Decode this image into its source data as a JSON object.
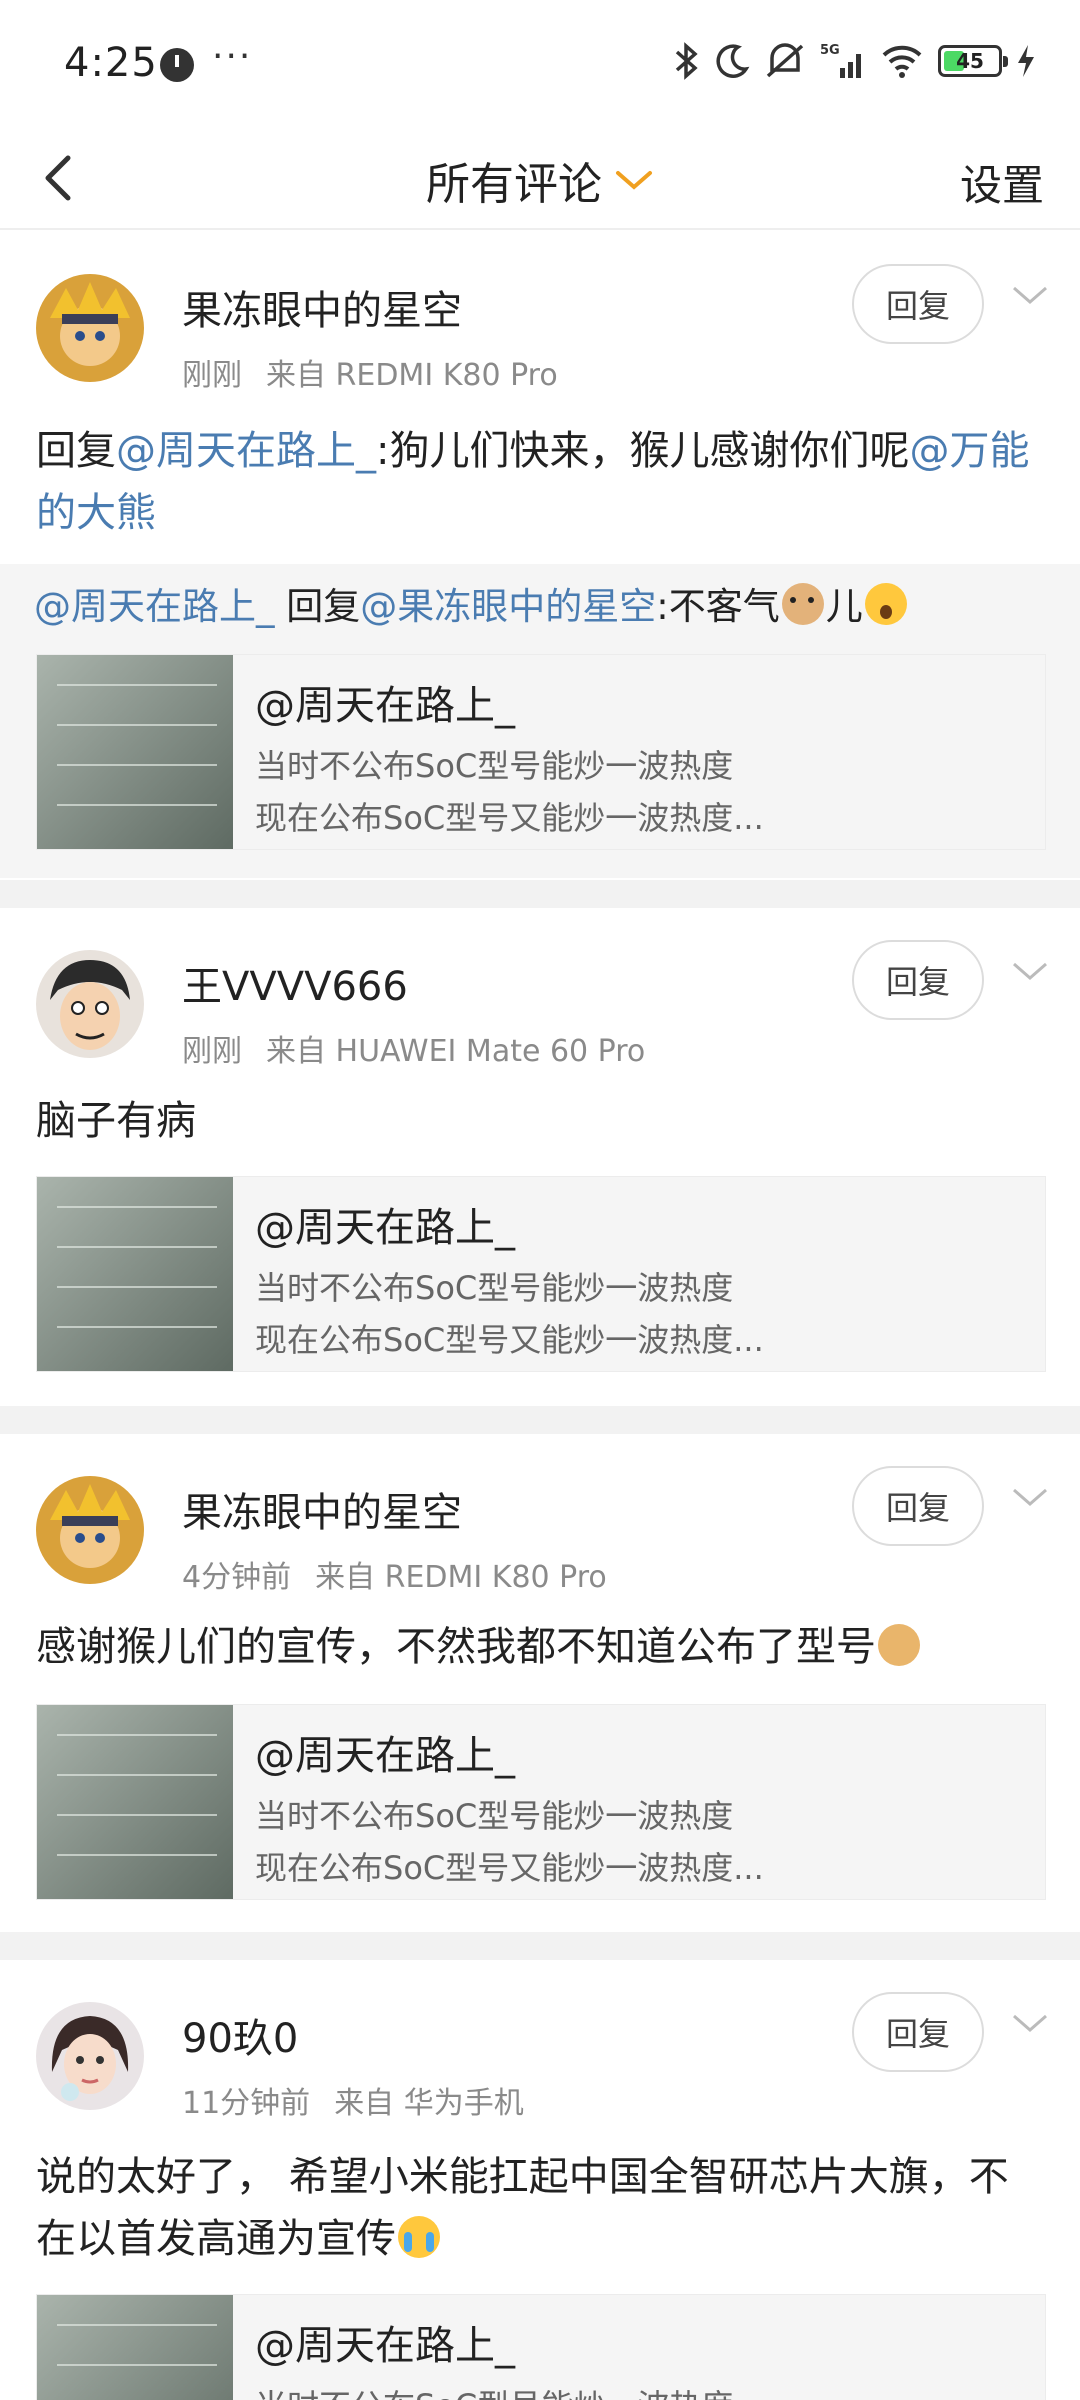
{
  "status_bar": {
    "time": "4:25",
    "more": "···",
    "battery": "45",
    "network": "5G",
    "icons": [
      "clock-icon",
      "bluetooth-icon",
      "do-not-disturb-icon",
      "mute-icon",
      "signal-icon",
      "wifi-icon",
      "battery-icon",
      "charging-icon"
    ]
  },
  "nav": {
    "title": "所有评论",
    "settings": "设置",
    "accent": "#f0a020"
  },
  "comments": [
    {
      "name": "果冻眼中的星空",
      "time": "刚刚",
      "source": "来自 REDMI K80 Pro",
      "reply_label": "回复",
      "text_prefix": "回复",
      "mention1": "@周天在路上_",
      "text_middle": ":狗儿们快来，猴儿感谢你们呢",
      "mention2": "@万能的大熊",
      "quote": {
        "mention1": "@周天在路上_",
        "middle": " 回复",
        "mention2": "@果冻眼中的星空",
        "text": ":不客气",
        "after_emoji": "儿"
      },
      "card": {
        "title": "@周天在路上_",
        "line1": "当时不公布SoC型号能炒一波热度",
        "line2": "现在公布SoC型号又能炒一波热度..."
      }
    },
    {
      "name": "王VVVV666",
      "time": "刚刚",
      "source": "来自 HUAWEI Mate 60 Pro",
      "reply_label": "回复",
      "text": "脑子有病",
      "card": {
        "title": "@周天在路上_",
        "line1": "当时不公布SoC型号能炒一波热度",
        "line2": "现在公布SoC型号又能炒一波热度..."
      }
    },
    {
      "name": "果冻眼中的星空",
      "time": "4分钟前",
      "source": "来自 REDMI K80 Pro",
      "reply_label": "回复",
      "text": "感谢猴儿们的宣传，不然我都不知道公布了型号",
      "card": {
        "title": "@周天在路上_",
        "line1": "当时不公布SoC型号能炒一波热度",
        "line2": "现在公布SoC型号又能炒一波热度..."
      }
    },
    {
      "name": "90玖0",
      "time": "11分钟前",
      "source": "来自 华为手机",
      "reply_label": "回复",
      "text": "说的太好了，  希望小米能扛起中国全智研芯片大旗，不在以首发高通为宣传",
      "card": {
        "title": "@周天在路上_",
        "line1": "当时不公布SoC型号能炒一波热度"
      }
    }
  ],
  "colors": {
    "mention": "#4a7cb1",
    "meta": "#8a8a8a",
    "divider": "#f2f2f2"
  }
}
